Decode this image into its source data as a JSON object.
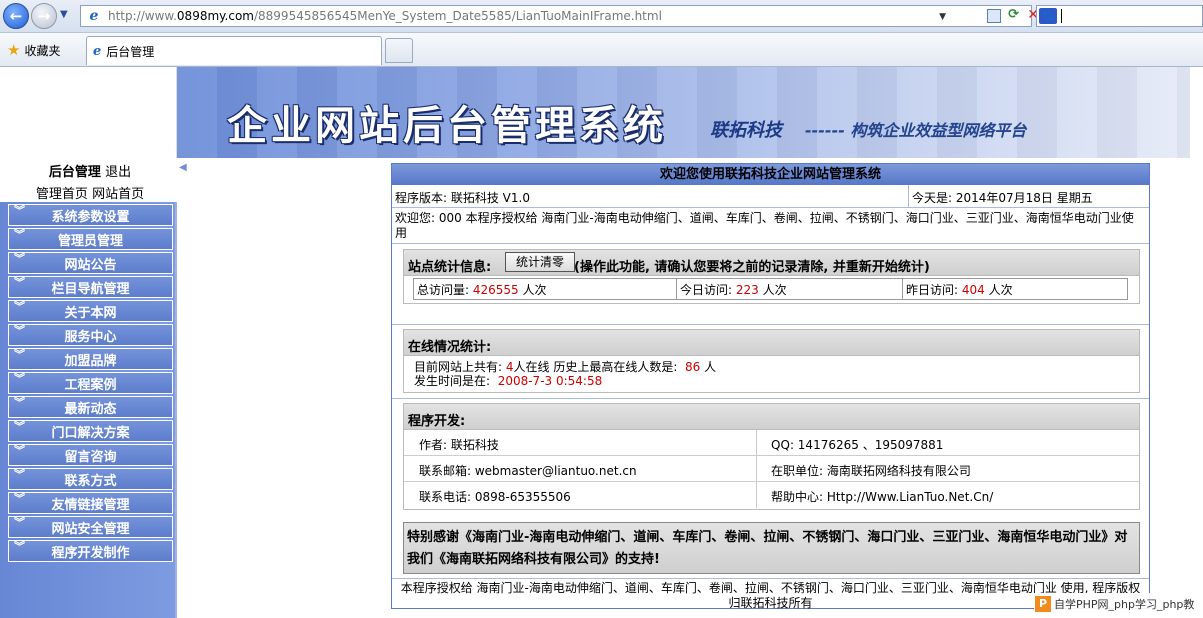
{
  "browser": {
    "url_prefix": "http://www.",
    "url_domain": "0898my.com",
    "url_path": "/8899545856545MenYe_System_Date5585/LianTuoMainIFrame.html",
    "favorites_label": "收藏夹",
    "tab_title": "后台管理"
  },
  "banner": {
    "title": "企业网站后台管理系统",
    "brand": "联拓科技",
    "slogan": "------ 构筑企业效益型网络平台"
  },
  "sidebar": {
    "admin_label": "后台管理",
    "logout_label": "退出",
    "home_link": "管理首页",
    "site_link": "网站首页",
    "menu": [
      "系统参数设置",
      "管理员管理",
      "网站公告",
      "栏目导航管理",
      "关于本网",
      "服务中心",
      "加盟品牌",
      "工程案例",
      "最新动态",
      "门口解决方案",
      "留言咨询",
      "联系方式",
      "友情链接管理",
      "网站安全管理",
      "程序开发制作"
    ]
  },
  "main": {
    "title": "欢迎您使用联拓科技企业网站管理系统",
    "version": "程序版本: 联拓科技 V1.0",
    "today": "今天是: 2014年07月18日 星期五",
    "welcome": "欢迎您: 000  本程序授权给 海南门业-海南电动伸缩门、道闸、车库门、卷闸、拉闸、不锈钢门、海口门业、三亚门业、海南恒华电动门业使用",
    "stats": {
      "heading": "站点统计信息:",
      "clear_button": "统计清零",
      "note": "(操作此功能, 请确认您要将之前的记录清除, 并重新开始统计)",
      "total_label": "总访问量:",
      "total_value": "426555",
      "today_label": "今日访问:",
      "today_value": "223",
      "yesterday_label": "昨日访问:",
      "yesterday_value": "404",
      "unit": "人次"
    },
    "online": {
      "heading": "在线情况统计:",
      "current_prefix": "目前网站上共有:",
      "current_value": "4",
      "current_suffix": "人在线 历史上最高在线人数是:",
      "max_value": "86",
      "max_unit": "人",
      "time_label": "发生时间是在:",
      "time_value": "2008-7-3 0:54:58"
    },
    "dev": {
      "heading": "程序开发:",
      "author": "作者: 联拓科技",
      "qq": "QQ: 14176265 、195097881",
      "email": "联系邮箱:  webmaster@liantuo.net.cn",
      "company": "在职单位: 海南联拓网络科技有限公司",
      "phone": "联系电话: 0898-65355506",
      "help": "帮助中心: Http://Www.LianTuo.Net.Cn/"
    },
    "thanks": "特别感谢《海南门业-海南电动伸缩门、道闸、车库门、卷闸、拉闸、不锈钢门、海口门业、三亚门业、海南恒华电动门业》对我们《海南联拓网络科技有限公司》的支持!",
    "footer": "本程序授权给 海南门业-海南电动伸缩门、道闸、车库门、卷闸、拉闸、不锈钢门、海口门业、三亚门业、海南恒华电动门业 使用, 程序版权归联拓科技所有"
  },
  "watermark": "自学PHP网_php学习_php教"
}
